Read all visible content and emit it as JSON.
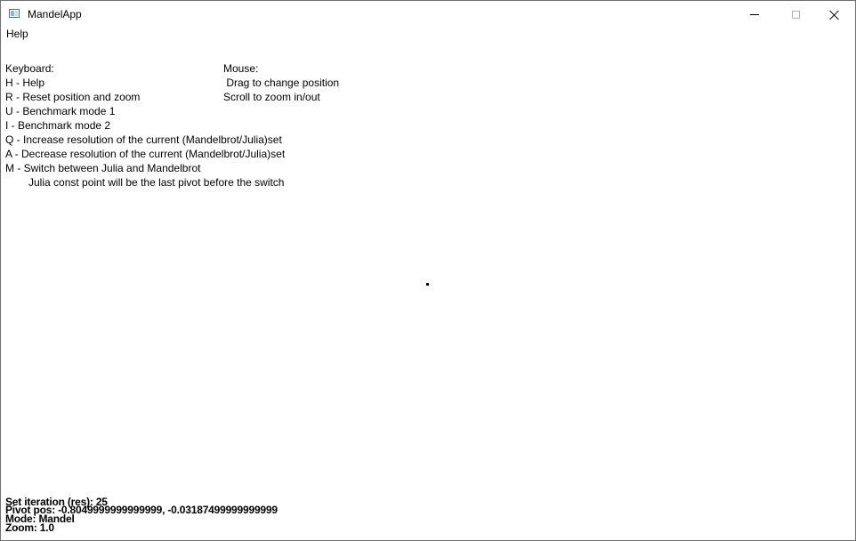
{
  "window": {
    "title": "MandelApp",
    "controls": {
      "minimize": "minimize",
      "maximize": "maximize",
      "close": "close"
    }
  },
  "menu": {
    "help": "Help"
  },
  "help": {
    "keyboard_header": "Keyboard:",
    "mouse_header": "Mouse:",
    "keyboard_lines": [
      "H - Help",
      "R - Reset position and zoom",
      "U - Benchmark mode 1",
      "I - Benchmark mode 2",
      "Q - Increase resolution of the current (Mandelbrot/Julia)set",
      "A - Decrease resolution of the current (Mandelbrot/Julia)set",
      "M - Switch between Julia and Mandelbrot",
      "Julia const point will be the last pivot before the switch"
    ],
    "mouse_lines": [
      " Drag to change position",
      "Scroll to zoom in/out"
    ]
  },
  "status": {
    "iteration": "Set iteration (res): 25",
    "pivot": "Pivot pos: -0.8049999999999999, -0.03187499999999999",
    "mode": "Mode: Mandel",
    "zoom": "Zoom: 1.0"
  }
}
